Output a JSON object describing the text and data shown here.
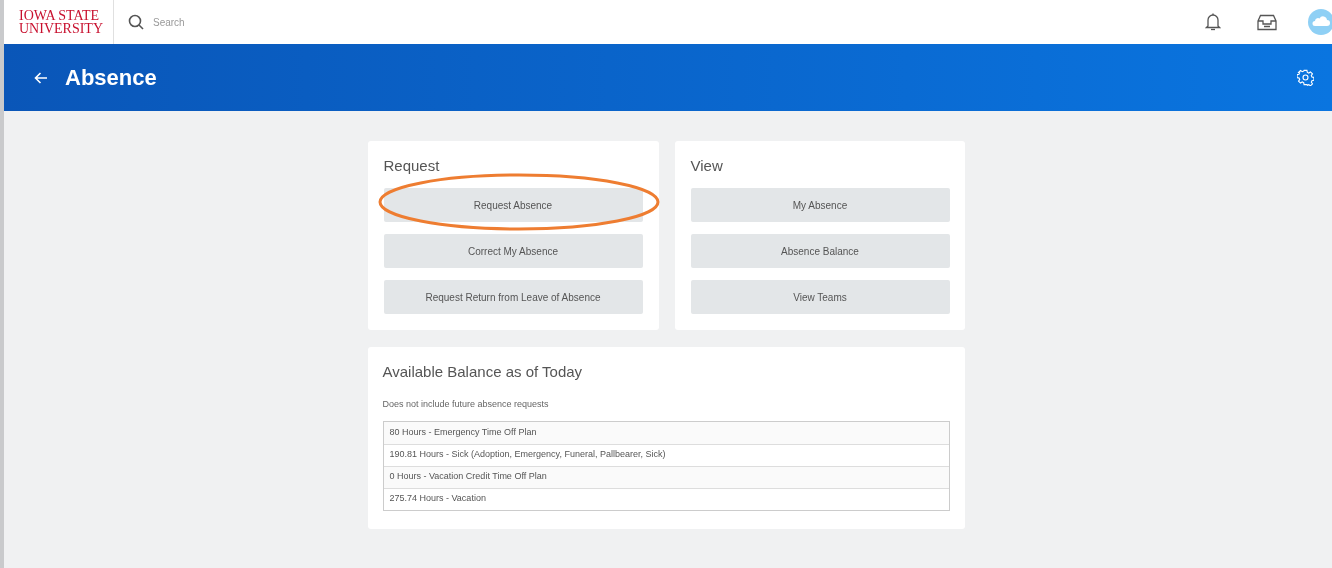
{
  "topbar": {
    "logo": [
      "IOWA STATE",
      "UNIVERSITY"
    ],
    "search": {
      "placeholder": "Search"
    }
  },
  "header": {
    "title": "Absence"
  },
  "request_card": {
    "title": "Request",
    "buttons": [
      {
        "label": "Request Absence",
        "circled": true
      },
      {
        "label": "Correct My Absence",
        "circled": false
      },
      {
        "label": "Request Return from Leave of Absence",
        "circled": false
      }
    ]
  },
  "view_card": {
    "title": "View",
    "buttons": [
      {
        "label": "My Absence",
        "circled": false
      },
      {
        "label": "Absence Balance",
        "circled": false
      },
      {
        "label": "View Teams",
        "circled": false
      }
    ]
  },
  "balance_card": {
    "title": "Available Balance as of Today",
    "note": "Does not include future absence requests",
    "rows": [
      "80 Hours - Emergency Time Off Plan",
      "190.81 Hours - Sick (Adoption, Emergency, Funeral, Pallbearer, Sick)",
      "0 Hours - Vacation Credit Time Off Plan",
      "275.74 Hours - Vacation"
    ]
  }
}
